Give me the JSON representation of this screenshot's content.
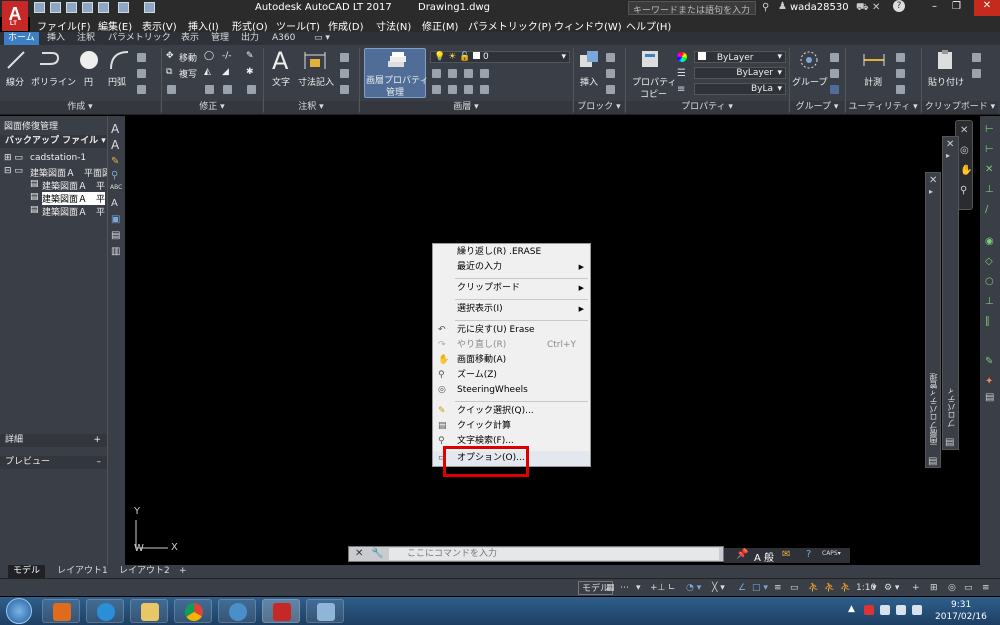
{
  "app": {
    "logo_text": "A",
    "logo_sub": "LT",
    "title": "Autodesk AutoCAD LT 2017",
    "document": "Drawing1.dwg",
    "search_placeholder": "キーワードまたは語句を入力",
    "user": "wada28530"
  },
  "menu": [
    "ファイル(F)",
    "編集(E)",
    "表示(V)",
    "挿入(I)",
    "形式(O)",
    "ツール(T)",
    "作成(D)",
    "寸法(N)",
    "修正(M)",
    "パラメトリック(P)",
    "ウィンドウ(W)",
    "ヘルプ(H)"
  ],
  "ribbon_tabs": [
    "ホーム",
    "挿入",
    "注釈",
    "パラメトリック",
    "表示",
    "管理",
    "出力",
    "A360"
  ],
  "ribbon": {
    "draw": {
      "line": "線分",
      "polyline": "ポリライン",
      "circle": "円",
      "arc": "円弧",
      "title": "作成"
    },
    "modify": {
      "move": "移動",
      "copy": "複写",
      "title": "修正"
    },
    "annotation": {
      "text": "文字",
      "dimension": "寸法記入",
      "title": "注釈"
    },
    "layers": {
      "props_button": "画層プロパティ管理",
      "props_button_l1": "画層プロパティ",
      "props_button_l2": "管理",
      "current_layer": "0",
      "title": "画層"
    },
    "block": {
      "insert": "挿入",
      "title": "ブロック"
    },
    "properties": {
      "match": "プロパティ",
      "match2": "コピー",
      "color": "ByLayer",
      "linetype": "ByLayer",
      "lineweight": "ByLa",
      "title": "プロパティ"
    },
    "groups": {
      "group": "グループ",
      "title": "グループ"
    },
    "utilities": {
      "measure": "計測",
      "title": "ユーティリティ"
    },
    "clipboard": {
      "paste": "貼り付け",
      "title": "クリップボード"
    }
  },
  "left_panel": {
    "title": "図面修復管理",
    "backup_header": "バックアップ ファイル",
    "tree": [
      {
        "label": "cadstation-1"
      },
      {
        "label": "建築図面Ａ　平面図"
      },
      {
        "label": "建築図面Ａ　平"
      },
      {
        "label": "建築図面Ａ　平"
      },
      {
        "label": "建築図面Ａ　平"
      }
    ],
    "details": "詳細",
    "preview": "プレビュー"
  },
  "ucs": {
    "y": "Y",
    "w": "W",
    "x": "X"
  },
  "palettes": {
    "properties": "プロパティ",
    "layer_props": "画層プロパティ管理"
  },
  "context_menu": {
    "items": [
      {
        "label": "繰り返し(R) .ERASE"
      },
      {
        "label": "最近の入力",
        "arrow": "▶"
      },
      {
        "label": "クリップボード",
        "arrow": "▶"
      },
      {
        "label": "選択表示(I)",
        "arrow": "▶"
      },
      {
        "label": "元に戻す(U) Erase"
      },
      {
        "label": "やり直し(R)",
        "shortcut": "Ctrl+Y"
      },
      {
        "label": "画面移動(A)"
      },
      {
        "label": "ズーム(Z)"
      },
      {
        "label": "SteeringWheels"
      },
      {
        "label": "クイック選択(Q)..."
      },
      {
        "label": "クイック計算"
      },
      {
        "label": "文字検索(F)..."
      },
      {
        "label": "オプション(O)..."
      }
    ]
  },
  "command_line": {
    "placeholder": "ここにコマンドを入力"
  },
  "layout_tabs": [
    "モデル",
    "レイアウト1",
    "レイアウト2",
    "+"
  ],
  "status": {
    "model": "モデル",
    "scale": "1:10"
  },
  "taskbar": {
    "time": "9:31",
    "date": "2017/02/16"
  },
  "colors": {
    "accent": "#3d7fc4",
    "highlight": "#e00000",
    "canvas": "#000000",
    "ribbon": "#3a3e46"
  }
}
